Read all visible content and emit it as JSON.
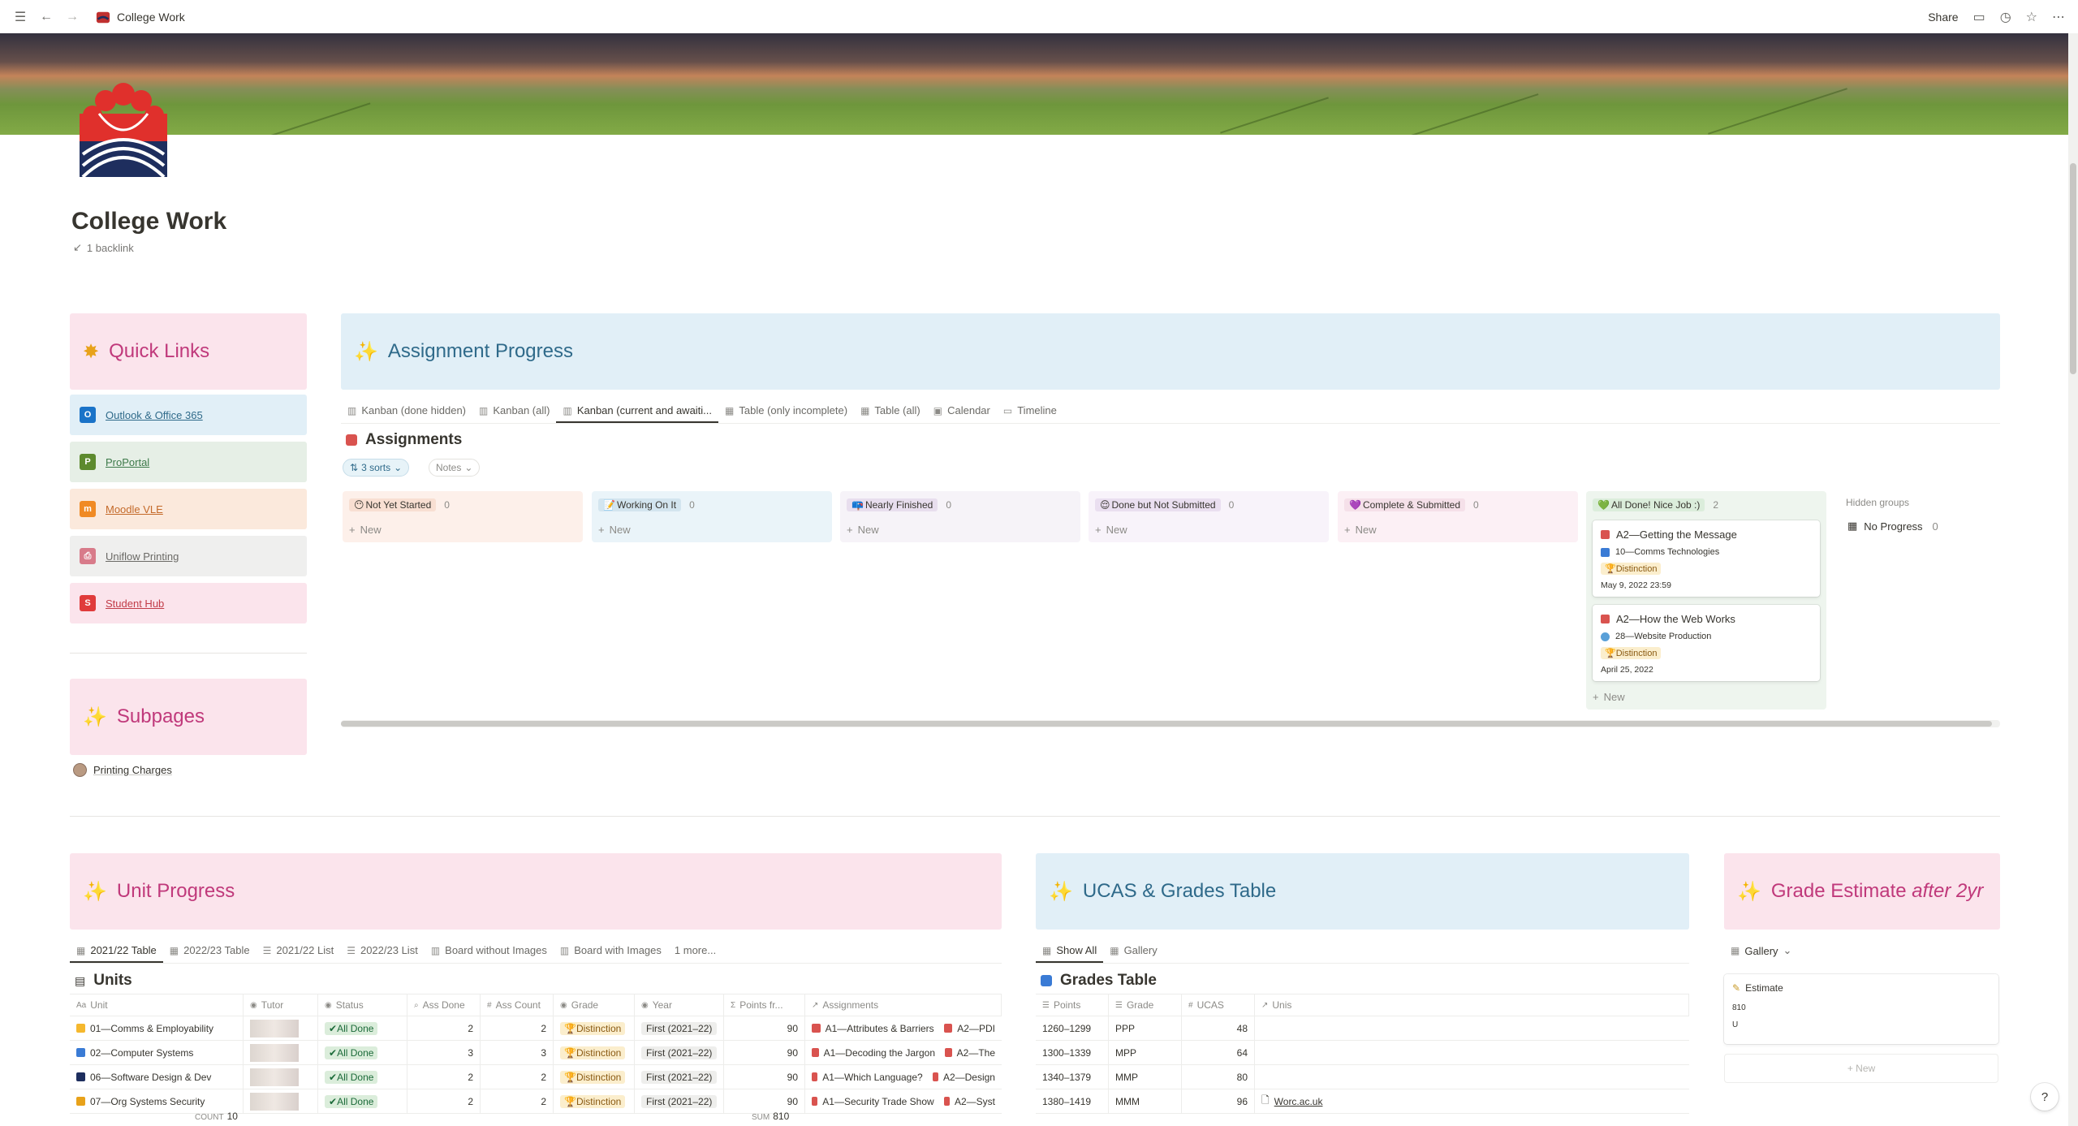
{
  "breadcrumb": {
    "title": "College Work"
  },
  "topbar": {
    "share": "Share"
  },
  "page": {
    "title": "College Work",
    "backlinks": "1 backlink"
  },
  "quick_links": {
    "title": "Quick Links",
    "items": [
      {
        "label": "Outlook & Office 365",
        "bg": "#e1eff7",
        "color": "#2f6a8a",
        "icon": "outlook-icon"
      },
      {
        "label": "ProPortal",
        "bg": "#e6efe6",
        "color": "#3d7a4a",
        "icon": "proportal-icon"
      },
      {
        "label": "Moodle VLE",
        "bg": "#fbe9dc",
        "color": "#c46a2a",
        "icon": "moodle-icon"
      },
      {
        "label": "Uniflow Printing",
        "bg": "#efefee",
        "color": "#6b6a66",
        "icon": "printer-icon"
      },
      {
        "label": "Student Hub",
        "bg": "#fbe4ec",
        "color": "#c23c48",
        "icon": "student-hub-icon"
      }
    ]
  },
  "subpages": {
    "title": "Subpages",
    "items": [
      {
        "label": "Printing Charges"
      }
    ]
  },
  "assignment_progress": {
    "title": "Assignment Progress",
    "tabs": [
      "Kanban (done hidden)",
      "Kanban (all)",
      "Kanban (current and awaiti...",
      "Table (only incomplete)",
      "Table (all)",
      "Calendar",
      "Timeline"
    ],
    "active_tab": 2,
    "db_title": "Assignments",
    "sorts": "3 sorts",
    "notes": "Notes",
    "columns": [
      {
        "label": "Not Yet Started",
        "emoji": "😶",
        "count": "0",
        "bg": "#fdf0ea",
        "tag": "#f8dfd2"
      },
      {
        "label": "Working On It",
        "emoji": "📝",
        "count": "0",
        "bg": "#eaf4f9",
        "tag": "#d3e5ef"
      },
      {
        "label": "Nearly Finished",
        "emoji": "📪",
        "count": "0",
        "bg": "#f6f3f8",
        "tag": "#e8deee"
      },
      {
        "label": "Done but Not Submitted",
        "emoji": "😌",
        "count": "0",
        "bg": "#f8f3fa",
        "tag": "#eadff0"
      },
      {
        "label": "Complete & Submitted",
        "emoji": "💜",
        "count": "0",
        "bg": "#fcf0f5",
        "tag": "#f5e0e9"
      },
      {
        "label": "All Done! Nice Job :)",
        "emoji": "💚",
        "count": "2",
        "bg": "#eef5ee",
        "tag": "#dbeddb"
      }
    ],
    "new_label": "New",
    "cards": [
      {
        "title": "A2—Getting the Message",
        "unit": "10—Comms Technologies",
        "grade": "Distinction",
        "date": "May 9, 2022 23:59"
      },
      {
        "title": "A2—How the Web Works",
        "unit": "28—Website Production",
        "grade": "Distinction",
        "date": "April 25, 2022"
      }
    ],
    "hidden_groups": "Hidden groups",
    "no_progress": "No Progress",
    "no_progress_count": "0"
  },
  "unit_progress": {
    "title": "Unit Progress",
    "tabs": [
      "2021/22 Table",
      "2022/23 Table",
      "2021/22 List",
      "2022/23 List",
      "Board without Images",
      "Board with Images",
      "1 more..."
    ],
    "db_title": "Units",
    "headers": [
      "Unit",
      "Tutor",
      "Status",
      "Ass Done",
      "Ass Count",
      "Grade",
      "Year",
      "Points fr...",
      "Assignments"
    ],
    "rows": [
      {
        "unit": "01—Comms & Employability",
        "status": "All Done",
        "done": "2",
        "count": "2",
        "grade": "Distinction",
        "year": "First (2021–22)",
        "points": "90",
        "a1": "A1—Attributes & Barriers",
        "a2": "A2—PDI"
      },
      {
        "unit": "02—Computer Systems",
        "status": "All Done",
        "done": "3",
        "count": "3",
        "grade": "Distinction",
        "year": "First (2021–22)",
        "points": "90",
        "a1": "A1—Decoding the Jargon",
        "a2": "A2—The"
      },
      {
        "unit": "06—Software Design & Dev",
        "status": "All Done",
        "done": "2",
        "count": "2",
        "grade": "Distinction",
        "year": "First (2021–22)",
        "points": "90",
        "a1": "A1—Which Language?",
        "a2": "A2—Design"
      },
      {
        "unit": "07—Org Systems Security",
        "status": "All Done",
        "done": "2",
        "count": "2",
        "grade": "Distinction",
        "year": "First (2021–22)",
        "points": "90",
        "a1": "A1—Security Trade Show",
        "a2": "A2—Syst"
      }
    ],
    "footer_count_label": "COUNT",
    "footer_count": "10",
    "footer_sum_label": "SUM",
    "footer_sum": "810"
  },
  "ucas": {
    "title": "UCAS & Grades Table",
    "tabs": [
      "Show All",
      "Gallery"
    ],
    "db_title": "Grades Table",
    "headers": [
      "Points",
      "Grade",
      "UCAS",
      "Unis"
    ],
    "rows": [
      {
        "points": "1260–1299",
        "grade": "PPP",
        "ucas": "48",
        "unis": ""
      },
      {
        "points": "1300–1339",
        "grade": "MPP",
        "ucas": "64",
        "unis": ""
      },
      {
        "points": "1340–1379",
        "grade": "MMP",
        "ucas": "80",
        "unis": ""
      },
      {
        "points": "1380–1419",
        "grade": "MMM",
        "ucas": "96",
        "unis": "Worc.ac.uk"
      }
    ]
  },
  "grade_estimate": {
    "title": "Grade Estimate",
    "title_em": "after 2yr",
    "view": "Gallery",
    "card_title": "Estimate",
    "card_value": "810",
    "card_grade": "U",
    "new_label": "New"
  },
  "help": "?"
}
